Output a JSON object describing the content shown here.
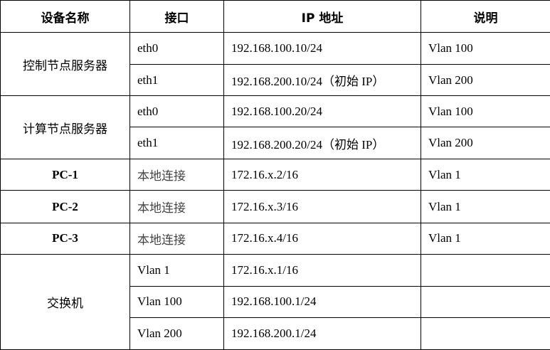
{
  "headers": {
    "device": "设备名称",
    "interface": "接口",
    "ip": "IP 地址",
    "note": "说明"
  },
  "groups": [
    {
      "device": "控制节点服务器",
      "rows": [
        {
          "interface": "eth0",
          "ip": "192.168.100.10/24",
          "note": "Vlan 100"
        },
        {
          "interface": "eth1",
          "ip": "192.168.200.10/24（初始 IP）",
          "note": "Vlan 200"
        }
      ]
    },
    {
      "device": "计算节点服务器",
      "rows": [
        {
          "interface": "eth0",
          "ip": "192.168.100.20/24",
          "note": "Vlan 100"
        },
        {
          "interface": "eth1",
          "ip": "192.168.200.20/24（初始 IP）",
          "note": "Vlan 200"
        }
      ]
    },
    {
      "device": "PC-1",
      "rows": [
        {
          "interface": "本地连接",
          "ip": "172.16.x.2/16",
          "note": "Vlan 1"
        }
      ]
    },
    {
      "device": "PC-2",
      "rows": [
        {
          "interface": "本地连接",
          "ip": "172.16.x.3/16",
          "note": "Vlan 1"
        }
      ]
    },
    {
      "device": "PC-3",
      "rows": [
        {
          "interface": "本地连接",
          "ip": "172.16.x.4/16",
          "note": "Vlan 1"
        }
      ]
    },
    {
      "device": "交换机",
      "rows": [
        {
          "interface": "Vlan 1",
          "ip": "172.16.x.1/16",
          "note": ""
        },
        {
          "interface": "Vlan 100",
          "ip": "192.168.100.1/24",
          "note": ""
        },
        {
          "interface": "Vlan 200",
          "ip": "192.168.200.1/24",
          "note": ""
        }
      ]
    }
  ]
}
